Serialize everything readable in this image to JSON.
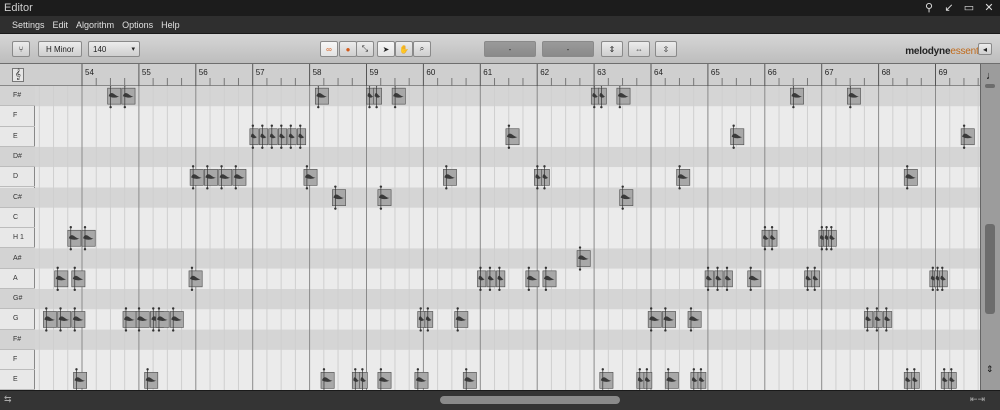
{
  "window": {
    "title": "Editor"
  },
  "menu": [
    "Settings",
    "Edit",
    "Algorithm",
    "Options",
    "Help"
  ],
  "toolbar": {
    "key_label": "H Minor",
    "tempo_value": "140",
    "field1_value": "-",
    "field2_value": "-",
    "brand_main": "melodyne",
    "brand_sub": "essential"
  },
  "ruler": {
    "bars": [
      "54",
      "55",
      "56",
      "57",
      "58",
      "59",
      "60",
      "61",
      "62",
      "63",
      "64",
      "65",
      "66",
      "67",
      "68",
      "69"
    ]
  },
  "keyboard": {
    "pitches": [
      "F#",
      "F",
      "E",
      "D#",
      "D",
      "C#",
      "C",
      "H 1",
      "A#",
      "A",
      "G#",
      "G",
      "F#",
      "F",
      "E"
    ]
  },
  "notes": [
    {
      "bar": 53.32,
      "beats": 0.75,
      "pitch": "G",
      "count": 3
    },
    {
      "bar": 53.52,
      "beats": 0.25,
      "pitch": "A",
      "count": 1
    },
    {
      "bar": 53.82,
      "beats": 0.25,
      "pitch": "A",
      "count": 1
    },
    {
      "bar": 53.75,
      "beats": 0.5,
      "pitch": "H 1",
      "count": 2
    },
    {
      "bar": 53.85,
      "beats": 0.25,
      "pitch": "E_low",
      "count": 1
    },
    {
      "bar": 54.45,
      "beats": 0.5,
      "pitch": "F#",
      "count": 2
    },
    {
      "bar": 54.72,
      "beats": 0.25,
      "pitch": "G",
      "count": 1
    },
    {
      "bar": 54.95,
      "beats": 0.5,
      "pitch": "G",
      "count": 2
    },
    {
      "bar": 55.3,
      "beats": 0.5,
      "pitch": "G",
      "count": 2
    },
    {
      "bar": 55.1,
      "beats": 0.25,
      "pitch": "E_low",
      "count": 1
    },
    {
      "bar": 55.9,
      "beats": 1.0,
      "pitch": "D",
      "count": 4
    },
    {
      "bar": 55.88,
      "beats": 0.25,
      "pitch": "A",
      "count": 1
    },
    {
      "bar": 56.95,
      "beats": 1.0,
      "pitch": "E",
      "count": 6
    },
    {
      "bar": 57.9,
      "beats": 0.25,
      "pitch": "D",
      "count": 1
    },
    {
      "bar": 58.1,
      "beats": 0.25,
      "pitch": "F#",
      "count": 1
    },
    {
      "bar": 58.4,
      "beats": 0.25,
      "pitch": "C#",
      "count": 1
    },
    {
      "bar": 58.2,
      "beats": 0.25,
      "pitch": "E_low",
      "count": 1
    },
    {
      "bar": 58.75,
      "beats": 0.25,
      "pitch": "E_low",
      "count": 2
    },
    {
      "bar": 59.0,
      "beats": 0.25,
      "pitch": "F#",
      "count": 2
    },
    {
      "bar": 59.2,
      "beats": 0.25,
      "pitch": "C#",
      "count": 1
    },
    {
      "bar": 59.45,
      "beats": 0.25,
      "pitch": "F#",
      "count": 1
    },
    {
      "bar": 59.2,
      "beats": 0.25,
      "pitch": "E_low",
      "count": 1
    },
    {
      "bar": 59.9,
      "beats": 0.25,
      "pitch": "G",
      "count": 2
    },
    {
      "bar": 59.85,
      "beats": 0.25,
      "pitch": "E_low",
      "count": 1
    },
    {
      "bar": 60.35,
      "beats": 0.25,
      "pitch": "D",
      "count": 1
    },
    {
      "bar": 60.55,
      "beats": 0.25,
      "pitch": "G",
      "count": 1
    },
    {
      "bar": 60.7,
      "beats": 0.25,
      "pitch": "E_low",
      "count": 1
    },
    {
      "bar": 60.95,
      "beats": 0.5,
      "pitch": "A",
      "count": 3
    },
    {
      "bar": 61.45,
      "beats": 0.25,
      "pitch": "E",
      "count": 1
    },
    {
      "bar": 61.8,
      "beats": 0.25,
      "pitch": "A",
      "count": 1
    },
    {
      "bar": 62.1,
      "beats": 0.25,
      "pitch": "A",
      "count": 1
    },
    {
      "bar": 61.95,
      "beats": 0.25,
      "pitch": "D",
      "count": 2
    },
    {
      "bar": 62.7,
      "beats": 0.25,
      "pitch": "A#",
      "count": 1
    },
    {
      "bar": 62.95,
      "beats": 0.25,
      "pitch": "F#",
      "count": 2
    },
    {
      "bar": 63.1,
      "beats": 0.25,
      "pitch": "E_low",
      "count": 1
    },
    {
      "bar": 63.4,
      "beats": 0.25,
      "pitch": "F#",
      "count": 1
    },
    {
      "bar": 63.45,
      "beats": 0.25,
      "pitch": "C#",
      "count": 1
    },
    {
      "bar": 63.75,
      "beats": 0.25,
      "pitch": "E_low",
      "count": 2
    },
    {
      "bar": 63.95,
      "beats": 0.5,
      "pitch": "G",
      "count": 2
    },
    {
      "bar": 64.25,
      "beats": 0.25,
      "pitch": "E_low",
      "count": 1
    },
    {
      "bar": 64.45,
      "beats": 0.25,
      "pitch": "D",
      "count": 1
    },
    {
      "bar": 64.65,
      "beats": 0.25,
      "pitch": "G",
      "count": 1
    },
    {
      "bar": 64.7,
      "beats": 0.25,
      "pitch": "E_low",
      "count": 2
    },
    {
      "bar": 64.95,
      "beats": 0.5,
      "pitch": "A",
      "count": 3
    },
    {
      "bar": 65.4,
      "beats": 0.25,
      "pitch": "E",
      "count": 1
    },
    {
      "bar": 65.7,
      "beats": 0.25,
      "pitch": "A",
      "count": 1
    },
    {
      "bar": 65.95,
      "beats": 0.25,
      "pitch": "H 1",
      "count": 2
    },
    {
      "bar": 66.45,
      "beats": 0.25,
      "pitch": "F#",
      "count": 1
    },
    {
      "bar": 66.7,
      "beats": 0.25,
      "pitch": "A",
      "count": 2
    },
    {
      "bar": 66.95,
      "beats": 0.25,
      "pitch": "H 1",
      "count": 3
    },
    {
      "bar": 67.45,
      "beats": 0.25,
      "pitch": "F#",
      "count": 1
    },
    {
      "bar": 67.75,
      "beats": 0.5,
      "pitch": "G",
      "count": 3
    },
    {
      "bar": 68.45,
      "beats": 0.25,
      "pitch": "D",
      "count": 1
    },
    {
      "bar": 68.9,
      "beats": 0.25,
      "pitch": "A",
      "count": 3
    },
    {
      "bar": 68.45,
      "beats": 0.25,
      "pitch": "E_low",
      "count": 2
    },
    {
      "bar": 69.45,
      "beats": 0.25,
      "pitch": "E",
      "count": 1
    },
    {
      "bar": 69.1,
      "beats": 0.25,
      "pitch": "E_low",
      "count": 2
    }
  ]
}
